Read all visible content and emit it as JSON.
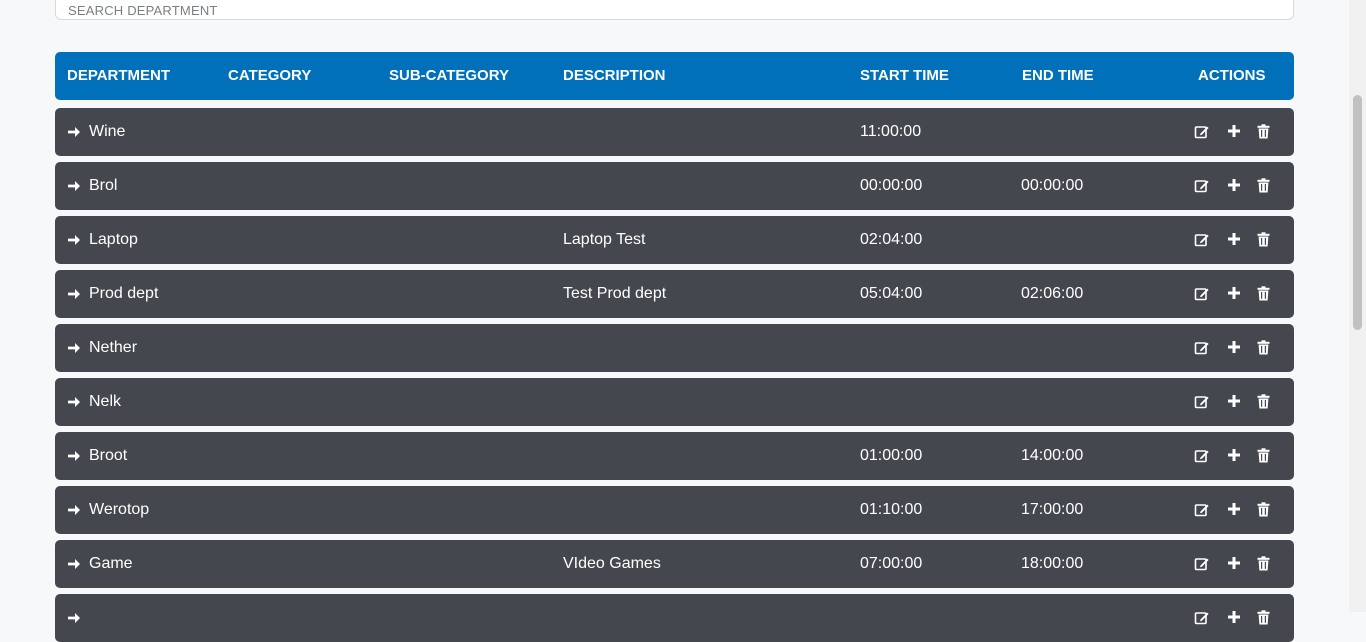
{
  "search": {
    "placeholder": "SEARCH DEPARTMENT",
    "value": ""
  },
  "table": {
    "headers": {
      "department": "DEPARTMENT",
      "category": "CATEGORY",
      "sub_category": "SUB-CATEGORY",
      "description": "DESCRIPTION",
      "start_time": "START TIME",
      "end_time": "END TIME",
      "actions": "ACTIONS"
    },
    "rows": [
      {
        "department": "Wine",
        "category": "",
        "sub_category": "",
        "description": "",
        "start_time": "11:00:00",
        "end_time": ""
      },
      {
        "department": "Brol",
        "category": "",
        "sub_category": "",
        "description": "",
        "start_time": "00:00:00",
        "end_time": "00:00:00"
      },
      {
        "department": "Laptop",
        "category": "",
        "sub_category": "",
        "description": "Laptop Test",
        "start_time": "02:04:00",
        "end_time": ""
      },
      {
        "department": "Prod dept",
        "category": "",
        "sub_category": "",
        "description": "Test Prod dept",
        "start_time": "05:04:00",
        "end_time": "02:06:00"
      },
      {
        "department": "Nether",
        "category": "",
        "sub_category": "",
        "description": "",
        "start_time": "",
        "end_time": ""
      },
      {
        "department": "Nelk",
        "category": "",
        "sub_category": "",
        "description": "",
        "start_time": "",
        "end_time": ""
      },
      {
        "department": "Broot",
        "category": "",
        "sub_category": "",
        "description": "",
        "start_time": "01:00:00",
        "end_time": "14:00:00"
      },
      {
        "department": "Werotop",
        "category": "",
        "sub_category": "",
        "description": "",
        "start_time": "01:10:00",
        "end_time": "17:00:00"
      },
      {
        "department": "Game",
        "category": "",
        "sub_category": "",
        "description": "VIdeo Games",
        "start_time": "07:00:00",
        "end_time": "18:00:00"
      },
      {
        "department": "",
        "category": "",
        "sub_category": "",
        "description": "",
        "start_time": "",
        "end_time": ""
      }
    ],
    "row_icons": {
      "expand": "arrow-right-icon",
      "edit": "edit-icon",
      "add": "plus-icon",
      "delete": "trash-icon"
    }
  },
  "colors": {
    "header_bg": "#0070ba",
    "row_bg": "#44474d",
    "page_bg": "#f7f8fa"
  }
}
